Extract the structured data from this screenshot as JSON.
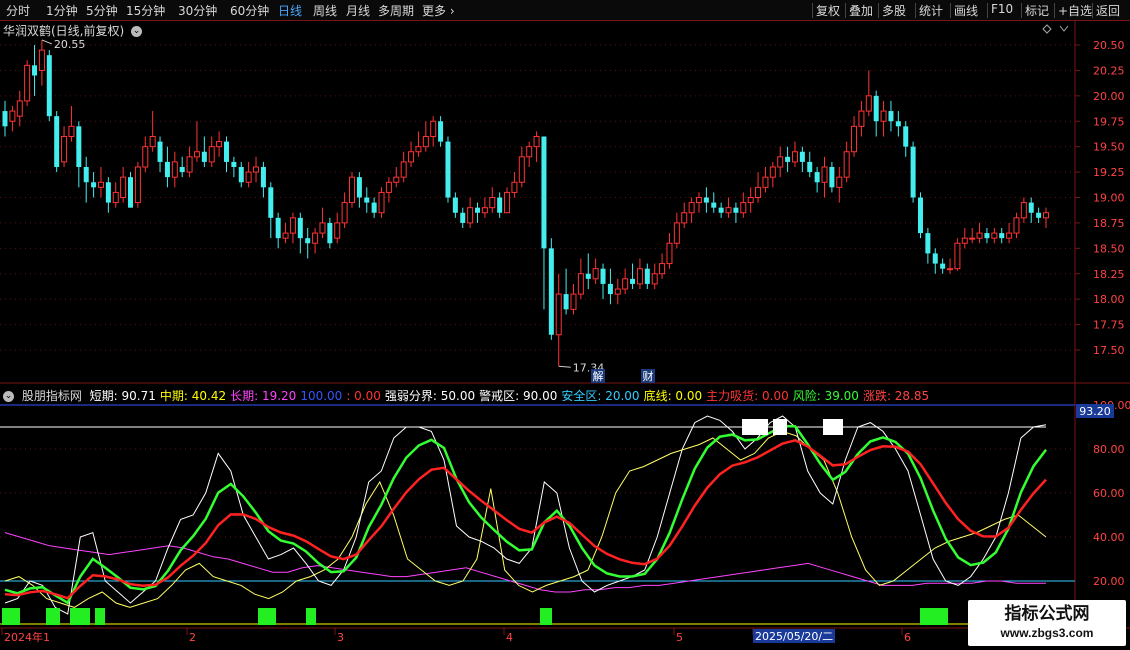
{
  "toolbar": {
    "periods": [
      "分时",
      "1分钟",
      "5分钟",
      "15分钟",
      "30分钟",
      "60分钟",
      "日线",
      "周线",
      "月线",
      "多周期",
      "更多"
    ],
    "active": "日线",
    "right": [
      "复权",
      "叠加",
      "多股",
      "统计",
      "画线",
      "F10",
      "标记",
      "+自选",
      "返回"
    ]
  },
  "chart_title": "华润双鹤(日线,前复权)",
  "price_axis": [
    "20.50",
    "20.25",
    "20.00",
    "19.75",
    "19.50",
    "19.25",
    "19.00",
    "18.75",
    "18.50",
    "18.25",
    "18.00",
    "17.75",
    "17.50"
  ],
  "price_high_label": "20.55",
  "price_low_label": "17.34",
  "markers": [
    "解",
    "财"
  ],
  "indicator": {
    "name": "股朋指标网",
    "items": [
      {
        "label": "短期: 90.71",
        "color": "#ffffff"
      },
      {
        "label": "中期: 40.42",
        "color": "#ffff00"
      },
      {
        "label": "长期: 19.20",
        "color": "#ff44ff"
      },
      {
        "label": "100.00",
        "color": "#3355ff"
      },
      {
        "label": ": 0.00",
        "color": "#ff3333"
      },
      {
        "label": "强弱分界: 50.00",
        "color": "#ffffff"
      },
      {
        "label": "警戒区: 90.00",
        "color": "#ffffff"
      },
      {
        "label": "安全区: 20.00",
        "color": "#33ccff"
      },
      {
        "label": "底线: 0.00",
        "color": "#ffff00"
      },
      {
        "label": "主力吸货: 0.00",
        "color": "#ff3333"
      },
      {
        "label": "风险: 39.00",
        "color": "#33ff33"
      },
      {
        "label": "涨跌: 28.85",
        "color": "#ff4444"
      }
    ],
    "current_value": "93.20"
  },
  "indicator_axis": [
    "100.00",
    "80.00",
    "60.00",
    "40.00",
    "20.00"
  ],
  "date_axis": [
    "2024年1",
    "2",
    "3",
    "4",
    "5",
    "2025/05/20/二",
    "6"
  ],
  "watermark": {
    "line1": "指标公式网",
    "line2": "www.zbgs3.com"
  },
  "colors": {
    "up": "#ff3333",
    "down": "#44eeee",
    "axis": "#7a1515",
    "text": "#d8d8d8"
  },
  "candles": [
    [
      19.85,
      19.7,
      19.95,
      19.6
    ],
    [
      19.75,
      19.85,
      19.9,
      19.65
    ],
    [
      19.8,
      19.95,
      20.05,
      19.7
    ],
    [
      19.95,
      20.3,
      20.35,
      19.9
    ],
    [
      20.3,
      20.2,
      20.5,
      20.0
    ],
    [
      20.25,
      20.45,
      20.55,
      20.1
    ],
    [
      20.4,
      19.8,
      20.45,
      19.75
    ],
    [
      19.8,
      19.3,
      19.85,
      19.25
    ],
    [
      19.35,
      19.6,
      19.7,
      19.3
    ],
    [
      19.6,
      19.7,
      19.9,
      19.55
    ],
    [
      19.7,
      19.3,
      19.75,
      19.1
    ],
    [
      19.3,
      19.15,
      19.4,
      18.95
    ],
    [
      19.15,
      19.1,
      19.25,
      19.0
    ],
    [
      19.1,
      19.15,
      19.3,
      19.0
    ],
    [
      19.15,
      18.95,
      19.2,
      18.85
    ],
    [
      18.95,
      19.05,
      19.15,
      18.9
    ],
    [
      19.0,
      19.2,
      19.3,
      18.95
    ],
    [
      19.2,
      18.9,
      19.25,
      18.9
    ],
    [
      18.95,
      19.3,
      19.35,
      18.9
    ],
    [
      19.3,
      19.5,
      19.6,
      19.25
    ],
    [
      19.5,
      19.6,
      19.85,
      19.45
    ],
    [
      19.55,
      19.35,
      19.6,
      19.25
    ],
    [
      19.35,
      19.2,
      19.5,
      19.1
    ],
    [
      19.2,
      19.35,
      19.45,
      19.1
    ],
    [
      19.3,
      19.25,
      19.4,
      19.2
    ],
    [
      19.25,
      19.4,
      19.5,
      19.2
    ],
    [
      19.4,
      19.45,
      19.75,
      19.35
    ],
    [
      19.45,
      19.35,
      19.6,
      19.3
    ],
    [
      19.35,
      19.5,
      19.6,
      19.3
    ],
    [
      19.5,
      19.55,
      19.65,
      19.4
    ],
    [
      19.55,
      19.35,
      19.6,
      19.25
    ],
    [
      19.35,
      19.3,
      19.4,
      19.2
    ],
    [
      19.3,
      19.15,
      19.35,
      19.1
    ],
    [
      19.15,
      19.25,
      19.35,
      19.1
    ],
    [
      19.25,
      19.3,
      19.4,
      19.15
    ],
    [
      19.3,
      19.1,
      19.35,
      19.0
    ],
    [
      19.1,
      18.8,
      19.15,
      18.6
    ],
    [
      18.8,
      18.6,
      18.85,
      18.5
    ],
    [
      18.6,
      18.65,
      18.75,
      18.55
    ],
    [
      18.65,
      18.8,
      18.85,
      18.55
    ],
    [
      18.8,
      18.6,
      18.85,
      18.45
    ],
    [
      18.6,
      18.55,
      18.7,
      18.4
    ],
    [
      18.55,
      18.65,
      18.7,
      18.45
    ],
    [
      18.65,
      18.75,
      18.9,
      18.6
    ],
    [
      18.75,
      18.55,
      18.8,
      18.5
    ],
    [
      18.6,
      18.75,
      18.85,
      18.55
    ],
    [
      18.75,
      18.95,
      19.05,
      18.7
    ],
    [
      18.95,
      19.2,
      19.25,
      18.9
    ],
    [
      19.2,
      19.0,
      19.25,
      18.9
    ],
    [
      19.0,
      18.95,
      19.1,
      18.85
    ],
    [
      18.95,
      18.85,
      19.0,
      18.8
    ],
    [
      18.85,
      19.05,
      19.1,
      18.8
    ],
    [
      19.05,
      19.15,
      19.2,
      18.95
    ],
    [
      19.15,
      19.2,
      19.3,
      19.1
    ],
    [
      19.2,
      19.35,
      19.45,
      19.15
    ],
    [
      19.35,
      19.45,
      19.55,
      19.3
    ],
    [
      19.45,
      19.5,
      19.65,
      19.4
    ],
    [
      19.5,
      19.6,
      19.75,
      19.45
    ],
    [
      19.6,
      19.75,
      19.8,
      19.5
    ],
    [
      19.75,
      19.55,
      19.8,
      19.5
    ],
    [
      19.55,
      19.0,
      19.6,
      18.95
    ],
    [
      19.0,
      18.85,
      19.05,
      18.8
    ],
    [
      18.85,
      18.75,
      18.9,
      18.7
    ],
    [
      18.75,
      18.9,
      19.0,
      18.7
    ],
    [
      18.9,
      18.85,
      18.95,
      18.75
    ],
    [
      18.85,
      18.9,
      19.0,
      18.8
    ],
    [
      18.9,
      19.0,
      19.1,
      18.85
    ],
    [
      19.0,
      18.85,
      19.05,
      18.8
    ],
    [
      18.85,
      19.05,
      19.1,
      18.85
    ],
    [
      19.05,
      19.15,
      19.25,
      19.0
    ],
    [
      19.15,
      19.4,
      19.5,
      19.1
    ],
    [
      19.4,
      19.5,
      19.55,
      19.3
    ],
    [
      19.5,
      19.6,
      19.65,
      19.35
    ],
    [
      19.6,
      18.5,
      19.0,
      17.9
    ],
    [
      18.5,
      17.65,
      18.6,
      17.6
    ],
    [
      17.65,
      18.05,
      18.25,
      17.34
    ],
    [
      18.05,
      17.9,
      18.3,
      17.85
    ],
    [
      17.9,
      18.05,
      18.15,
      17.85
    ],
    [
      18.05,
      18.25,
      18.4,
      18.0
    ],
    [
      18.25,
      18.2,
      18.45,
      18.1
    ],
    [
      18.2,
      18.3,
      18.4,
      18.15
    ],
    [
      18.3,
      18.15,
      18.35,
      18.0
    ],
    [
      18.15,
      18.05,
      18.3,
      17.95
    ],
    [
      18.05,
      18.1,
      18.2,
      17.95
    ],
    [
      18.1,
      18.2,
      18.3,
      18.05
    ],
    [
      18.2,
      18.15,
      18.35,
      18.1
    ],
    [
      18.15,
      18.3,
      18.4,
      18.1
    ],
    [
      18.3,
      18.15,
      18.35,
      18.1
    ],
    [
      18.15,
      18.25,
      18.35,
      18.1
    ],
    [
      18.25,
      18.35,
      18.45,
      18.2
    ],
    [
      18.35,
      18.55,
      18.65,
      18.3
    ],
    [
      18.55,
      18.75,
      18.85,
      18.5
    ],
    [
      18.75,
      18.85,
      18.95,
      18.7
    ],
    [
      18.85,
      18.95,
      19.0,
      18.75
    ],
    [
      18.95,
      19.0,
      19.05,
      18.85
    ],
    [
      19.0,
      18.95,
      19.1,
      18.85
    ],
    [
      18.95,
      18.9,
      19.05,
      18.85
    ],
    [
      18.9,
      18.85,
      18.95,
      18.8
    ],
    [
      18.85,
      18.9,
      19.0,
      18.8
    ],
    [
      18.9,
      18.85,
      18.95,
      18.75
    ],
    [
      18.85,
      18.95,
      19.05,
      18.8
    ],
    [
      18.95,
      19.0,
      19.1,
      18.85
    ],
    [
      19.0,
      19.1,
      19.25,
      18.95
    ],
    [
      19.1,
      19.2,
      19.3,
      19.05
    ],
    [
      19.2,
      19.3,
      19.35,
      19.1
    ],
    [
      19.3,
      19.4,
      19.5,
      19.2
    ],
    [
      19.4,
      19.35,
      19.5,
      19.25
    ],
    [
      19.35,
      19.45,
      19.55,
      19.3
    ],
    [
      19.45,
      19.35,
      19.5,
      19.25
    ],
    [
      19.35,
      19.25,
      19.45,
      19.2
    ],
    [
      19.25,
      19.15,
      19.3,
      19.05
    ],
    [
      19.15,
      19.3,
      19.4,
      19.0
    ],
    [
      19.3,
      19.1,
      19.35,
      19.05
    ],
    [
      19.1,
      19.2,
      19.3,
      18.95
    ],
    [
      19.2,
      19.45,
      19.55,
      19.15
    ],
    [
      19.45,
      19.7,
      19.8,
      19.4
    ],
    [
      19.7,
      19.85,
      19.95,
      19.6
    ],
    [
      19.85,
      20.0,
      20.25,
      19.8
    ],
    [
      20.0,
      19.75,
      20.05,
      19.6
    ],
    [
      19.75,
      19.85,
      19.95,
      19.6
    ],
    [
      19.85,
      19.75,
      19.95,
      19.65
    ],
    [
      19.75,
      19.7,
      19.85,
      19.6
    ],
    [
      19.7,
      19.5,
      19.75,
      19.4
    ],
    [
      19.5,
      19.0,
      19.55,
      18.95
    ],
    [
      19.0,
      18.65,
      19.05,
      18.6
    ],
    [
      18.65,
      18.45,
      18.7,
      18.35
    ],
    [
      18.45,
      18.35,
      18.5,
      18.25
    ],
    [
      18.35,
      18.3,
      18.4,
      18.25
    ],
    [
      18.3,
      18.3,
      18.4,
      18.25
    ],
    [
      18.3,
      18.55,
      18.6,
      18.28
    ],
    [
      18.55,
      18.6,
      18.7,
      18.5
    ],
    [
      18.6,
      18.6,
      18.7,
      18.55
    ],
    [
      18.6,
      18.65,
      18.75,
      18.55
    ],
    [
      18.65,
      18.6,
      18.7,
      18.55
    ],
    [
      18.6,
      18.65,
      18.7,
      18.55
    ],
    [
      18.65,
      18.6,
      18.7,
      18.55
    ],
    [
      18.6,
      18.65,
      18.75,
      18.55
    ],
    [
      18.65,
      18.8,
      18.85,
      18.6
    ],
    [
      18.8,
      18.95,
      19.0,
      18.75
    ],
    [
      18.95,
      18.85,
      19.0,
      18.75
    ],
    [
      18.85,
      18.8,
      18.9,
      18.75
    ],
    [
      18.8,
      18.85,
      18.9,
      18.7
    ]
  ],
  "series": {
    "short": [
      10,
      12,
      20,
      18,
      8,
      5,
      40,
      42,
      20,
      15,
      10,
      15,
      20,
      35,
      48,
      50,
      60,
      78,
      70,
      50,
      40,
      30,
      32,
      35,
      28,
      20,
      18,
      25,
      40,
      65,
      70,
      85,
      90,
      90,
      88,
      75,
      45,
      40,
      38,
      35,
      30,
      28,
      35,
      65,
      60,
      35,
      20,
      15,
      18,
      20,
      22,
      25,
      40,
      60,
      80,
      92,
      95,
      93,
      88,
      80,
      85,
      92,
      95,
      90,
      70,
      60,
      55,
      75,
      90,
      92,
      88,
      80,
      70,
      50,
      30,
      20,
      18,
      22,
      30,
      40,
      60,
      85,
      90,
      91
    ],
    "middle": [
      20,
      22,
      18,
      12,
      10,
      8,
      12,
      15,
      10,
      8,
      10,
      12,
      18,
      25,
      28,
      22,
      20,
      18,
      14,
      12,
      15,
      20,
      22,
      25,
      30,
      40,
      55,
      65,
      50,
      30,
      25,
      20,
      18,
      20,
      30,
      62,
      25,
      18,
      15,
      18,
      20,
      22,
      25,
      40,
      60,
      70,
      72,
      75,
      78,
      80,
      82,
      85,
      80,
      75,
      78,
      85,
      88,
      86,
      80,
      75,
      60,
      40,
      25,
      18,
      20,
      25,
      30,
      35,
      38,
      40,
      42,
      45,
      48,
      50,
      45,
      40
    ],
    "long": [
      42,
      40,
      38,
      36,
      35,
      34,
      33,
      32,
      33,
      34,
      35,
      36,
      35,
      33,
      31,
      30,
      28,
      26,
      24,
      24,
      26,
      27,
      26,
      25,
      24,
      23,
      22,
      22,
      23,
      24,
      25,
      26,
      24,
      22,
      20,
      18,
      16,
      15,
      15,
      16,
      16,
      17,
      17,
      18,
      18,
      19,
      20,
      21,
      22,
      23,
      24,
      25,
      26,
      27,
      28,
      26,
      24,
      22,
      20,
      18,
      18,
      18,
      19,
      19,
      19,
      19,
      20,
      20,
      19,
      19,
      19
    ]
  }
}
